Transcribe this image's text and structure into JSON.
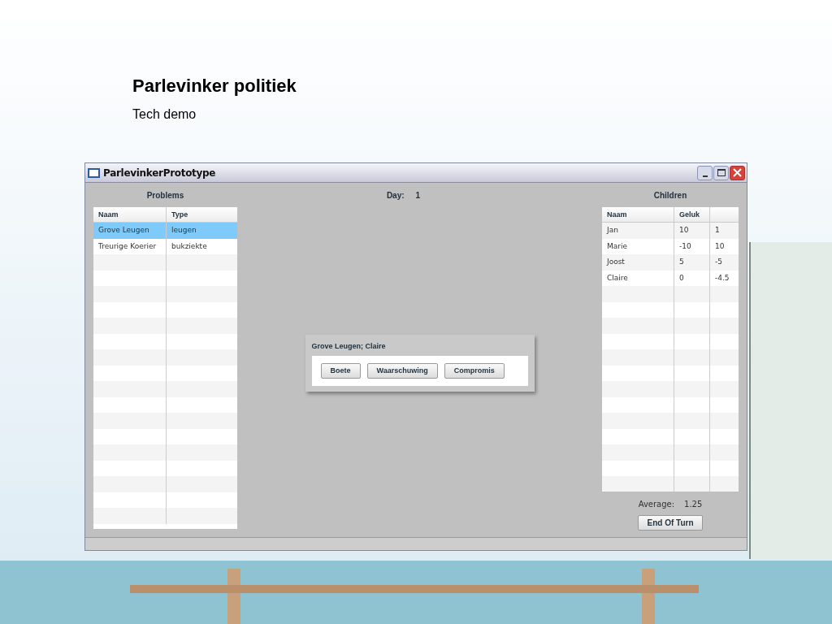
{
  "slide": {
    "title": "Parlevinker politiek",
    "subtitle": "Tech demo"
  },
  "window": {
    "title": "ParlevinkerPrototype"
  },
  "problems": {
    "heading": "Problems",
    "columns": [
      "Naam",
      "Type"
    ],
    "rows": [
      {
        "cells": [
          "Grove Leugen",
          "leugen"
        ],
        "selected": true
      },
      {
        "cells": [
          "Treurige Koerier",
          "bukziekte"
        ],
        "selected": false
      }
    ]
  },
  "day": {
    "label": "Day:",
    "value": "1"
  },
  "dialog": {
    "title": "Grove Leugen; Claire",
    "buttons": [
      "Boete",
      "Waarschuwing",
      "Compromis"
    ]
  },
  "children": {
    "heading": "Children",
    "columns": [
      "Naam",
      "Geluk"
    ],
    "rows": [
      {
        "cells": [
          "Jan",
          "10",
          "1"
        ]
      },
      {
        "cells": [
          "Marie",
          "-10",
          "10"
        ]
      },
      {
        "cells": [
          "Joost",
          "5",
          "-5"
        ]
      },
      {
        "cells": [
          "Claire",
          "0",
          "-4.5"
        ]
      }
    ]
  },
  "average": {
    "label": "Average:",
    "value": "1.25"
  },
  "end_turn_button": "End Of Turn"
}
